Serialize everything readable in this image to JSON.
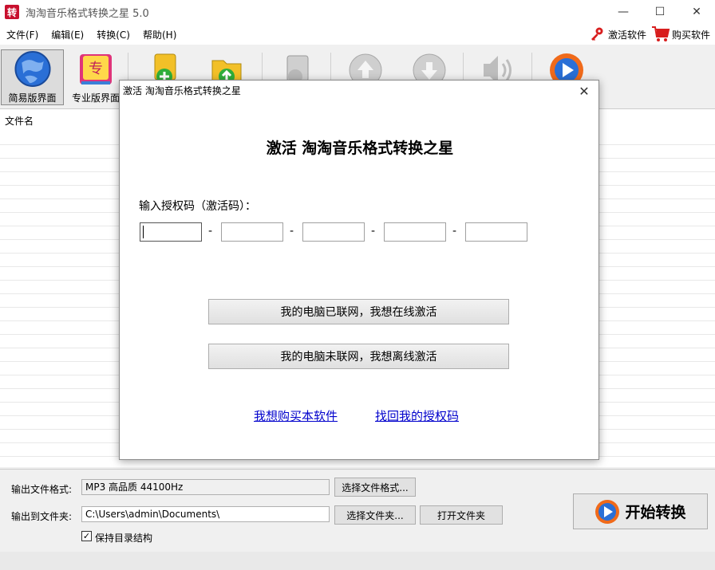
{
  "window": {
    "title": "淘淘音乐格式转换之星 5.0",
    "icon_text": "转",
    "minimize": "—",
    "maximize": "☐",
    "close": "✕"
  },
  "menu": {
    "items": [
      "文件(F)",
      "编辑(E)",
      "转换(C)",
      "帮助(H)"
    ],
    "activate": "激活软件",
    "buy": "购买软件"
  },
  "toolbar": {
    "simple_label": "简易版界面",
    "pro_label": "专业版界面",
    "pro_icon_text": "专"
  },
  "file_list": {
    "column_header": "文件名"
  },
  "bottom": {
    "output_format_label": "输出文件格式:",
    "output_format_value": "MP3 高品质 44100Hz",
    "select_format_button": "选择文件格式...",
    "output_folder_label": "输出到文件夹:",
    "output_folder_value": "C:\\Users\\admin\\Documents\\",
    "select_folder_button": "选择文件夹...",
    "open_folder_button": "打开文件夹",
    "keep_structure_label": "保持目录结构",
    "keep_structure_checked": "✓",
    "start_button": "开始转换"
  },
  "dialog": {
    "title": "激活 淘淘音乐格式转换之星",
    "close": "✕",
    "heading": "激活 淘淘音乐格式转换之星",
    "prompt": "输入授权码（激活码）：",
    "code_fields": [
      "",
      "",
      "",
      "",
      ""
    ],
    "separator": "-",
    "online_button": "我的电脑已联网，我想在线激活",
    "offline_button": "我的电脑未联网，我想离线激活",
    "buy_link": "我想购买本软件",
    "recover_link": "找回我的授权码"
  },
  "colors": {
    "accent_red": "#c8102e",
    "link_blue": "#0000cc",
    "play_orange": "#f06a1a",
    "play_blue": "#2a6fd6"
  }
}
